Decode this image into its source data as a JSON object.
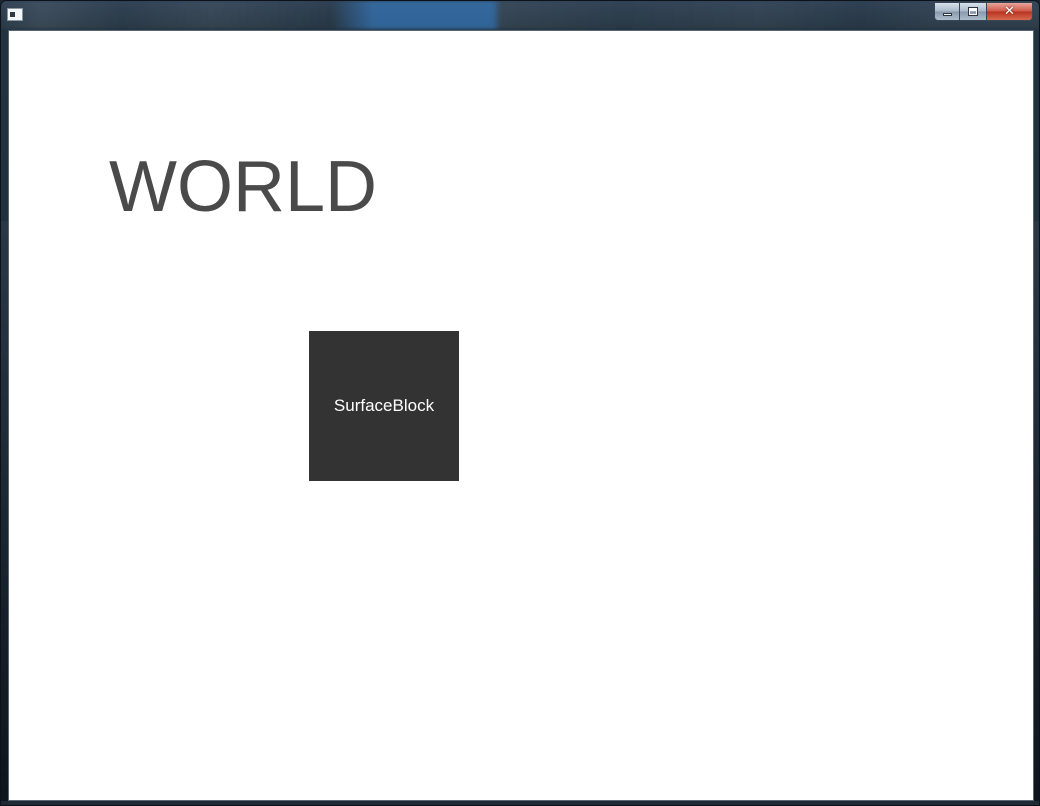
{
  "window": {
    "title": "",
    "icon": "app-window-icon",
    "controls": {
      "minimize": "minimize-icon",
      "maximize": "maximize-icon",
      "close_glyph": "✕"
    },
    "accent_close": "#c7402d"
  },
  "scene": {
    "heading": "WORLD",
    "heading_color": "#4a4a4a",
    "block": {
      "label": "SurfaceBlock",
      "fill": "#333333",
      "text_color": "#ffffff"
    },
    "background": "#ffffff"
  }
}
